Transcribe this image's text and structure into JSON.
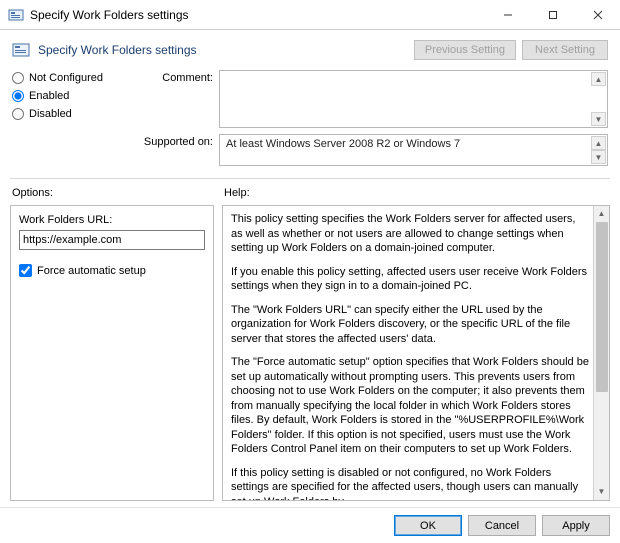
{
  "window": {
    "title": "Specify Work Folders settings",
    "minimize": "—",
    "maximize": "▢",
    "close": "✕"
  },
  "header": {
    "title": "Specify Work Folders settings",
    "prev_btn": "Previous Setting",
    "next_btn": "Next Setting"
  },
  "state": {
    "not_configured_label": "Not Configured",
    "enabled_label": "Enabled",
    "disabled_label": "Disabled",
    "selected": "enabled",
    "comment_label": "Comment:",
    "comment_value": "",
    "supported_label": "Supported on:",
    "supported_value": "At least Windows Server 2008 R2 or Windows 7"
  },
  "sections": {
    "options_label": "Options:",
    "help_label": "Help:"
  },
  "options": {
    "url_label": "Work Folders URL:",
    "url_value": "https://example.com",
    "force_label": "Force automatic setup",
    "force_checked": true
  },
  "help": {
    "p1": "This policy setting specifies the Work Folders server for affected users, as well as whether or not users are allowed to change settings when setting up Work Folders on a domain-joined computer.",
    "p2": "If you enable this policy setting, affected users user receive Work Folders settings when they sign in to a domain-joined PC.",
    "p3": "The \"Work Folders URL\" can specify either the URL used by the organization for Work Folders discovery, or the specific URL of the file server that stores the affected users' data.",
    "p4": "The \"Force automatic setup\" option specifies that Work Folders should be set up automatically without prompting users. This prevents users from choosing not to use Work Folders on the computer; it also prevents them from manually specifying the local folder in which Work Folders stores files. By default, Work Folders is stored in the \"%USERPROFILE%\\Work Folders\" folder. If this option is not specified, users must use the Work Folders Control Panel item on their computers to set up Work Folders.",
    "p5": "If this policy setting is disabled or not configured, no Work Folders settings are specified for the affected users, though users can manually set up Work Folders by"
  },
  "buttons": {
    "ok": "OK",
    "cancel": "Cancel",
    "apply": "Apply"
  }
}
